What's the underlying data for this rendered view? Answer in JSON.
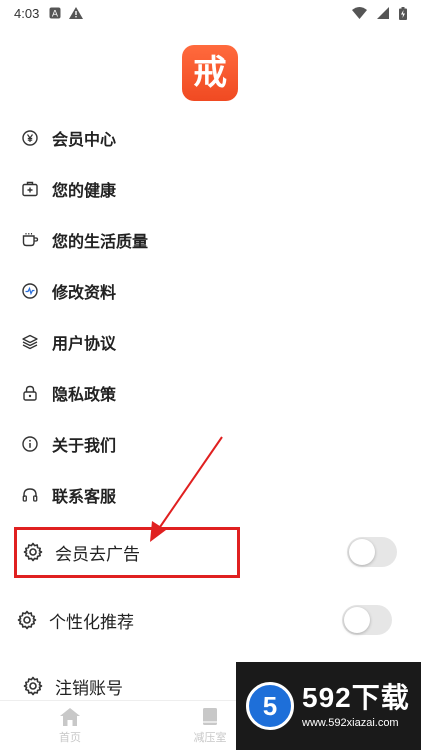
{
  "status_bar": {
    "time": "4:03",
    "left_icons": [
      "notification-a-icon",
      "warning-icon"
    ],
    "right_icons": [
      "wifi-icon",
      "signal-icon",
      "battery-icon"
    ]
  },
  "app_logo": {
    "text": "戒",
    "color": "#f04a22",
    "icon": "app-logo"
  },
  "menu": {
    "items": [
      {
        "label": "会员中心",
        "icon": "yen-circle-icon"
      },
      {
        "label": "您的健康",
        "icon": "medical-kit-icon"
      },
      {
        "label": "您的生活质量",
        "icon": "coffee-cup-icon"
      },
      {
        "label": "修改资料",
        "icon": "edit-profile-icon"
      },
      {
        "label": "用户协议",
        "icon": "layers-icon"
      },
      {
        "label": "隐私政策",
        "icon": "lock-icon"
      },
      {
        "label": "关于我们",
        "icon": "info-icon"
      },
      {
        "label": "联系客服",
        "icon": "headset-icon"
      }
    ]
  },
  "settings": {
    "remove_ads": {
      "label": "会员去广告",
      "icon": "gear-icon",
      "enabled": false
    },
    "personalized": {
      "label": "个性化推荐",
      "icon": "gear-icon",
      "enabled": false
    },
    "deactivate": {
      "label": "注销账号",
      "icon": "gear-icon"
    }
  },
  "bottom_nav": {
    "items": [
      {
        "label": "首页",
        "icon": "home-icon"
      },
      {
        "label": "减压室",
        "icon": "book-icon"
      }
    ]
  },
  "watermark": {
    "title": "592下载",
    "url": "www.592xiazai.com",
    "badge": "5"
  },
  "colors": {
    "accent": "#f04a22",
    "highlight": "#e02020",
    "toggle_off": "#e6e6e6",
    "watermark_blue": "#1e6fd9"
  }
}
